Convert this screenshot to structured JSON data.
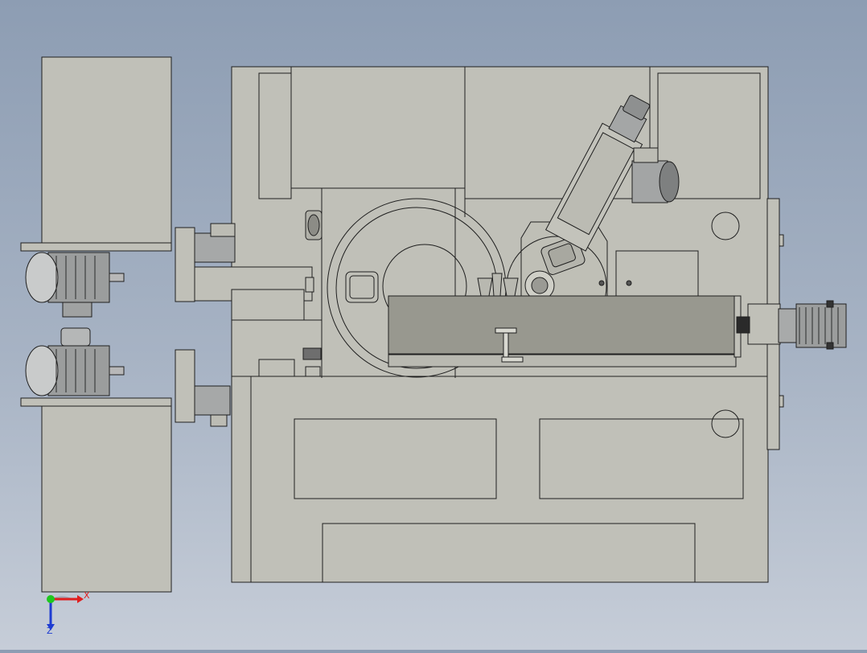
{
  "viewport": {
    "background_top": "#8d9db3",
    "background_bottom": "#c6cdd8"
  },
  "model": {
    "body_color": "#c0c0b8",
    "panel_color": "#bdbdb4",
    "slide_color": "#98988f",
    "motor_color": "#9a9c9c",
    "edge_color": "#1f1f1f"
  },
  "triad": {
    "x_label": "X",
    "z_label": "Z",
    "x_color": "#e01e1e",
    "y_color": "#1ec81e",
    "z_color": "#1e3cd2"
  }
}
